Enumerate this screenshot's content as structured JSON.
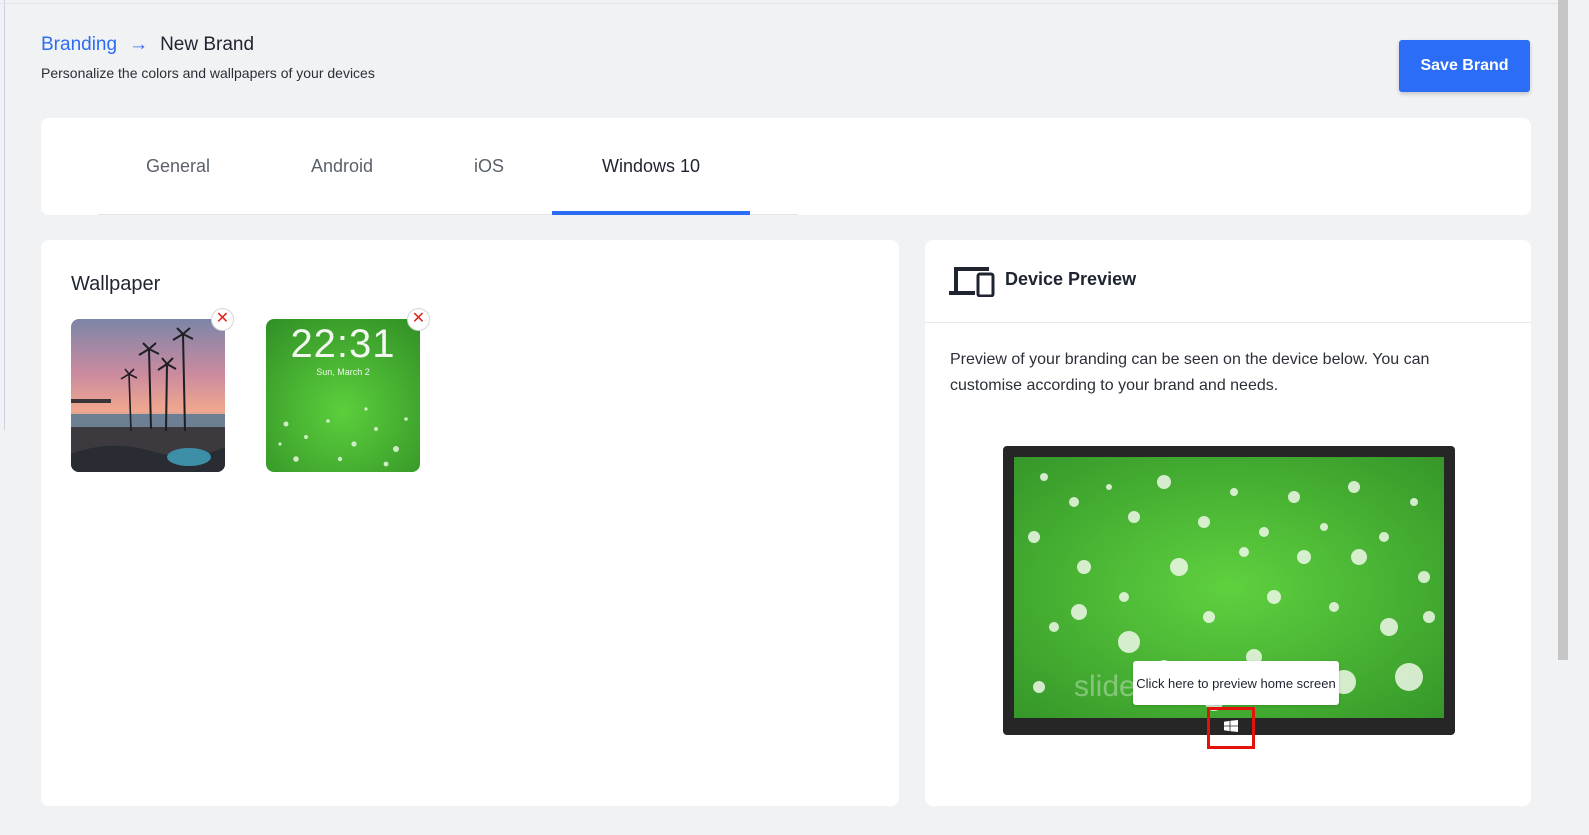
{
  "header": {
    "breadcrumb_parent": "Branding",
    "breadcrumb_arrow": "→",
    "breadcrumb_current": "New Brand",
    "subtitle": "Personalize the colors and wallpapers of your devices"
  },
  "actions": {
    "save_label": "Save Brand"
  },
  "tabs": [
    {
      "label": "General",
      "active": false
    },
    {
      "label": "Android",
      "active": false
    },
    {
      "label": "iOS",
      "active": false
    },
    {
      "label": "Windows 10",
      "active": true
    }
  ],
  "wallpaper": {
    "title": "Wallpaper",
    "remove_symbol": "✕",
    "items": [
      {
        "name": "beach-sunset"
      },
      {
        "name": "green-water-drops",
        "lock_time": "22:31",
        "lock_date": "Sun, March 2"
      }
    ]
  },
  "preview": {
    "title": "Device Preview",
    "description": "Preview of your branding can be seen on the device below. You can customise according to your brand and needs.",
    "screen_text": "slide",
    "tooltip": "Click here to preview home screen"
  },
  "colors": {
    "accent": "#2b6df6",
    "link": "#2d6cf5",
    "remove": "#e0251b",
    "highlight": "#e3120b"
  },
  "icons": {
    "arrow": "arrow-right-icon",
    "devices": "devices-icon",
    "remove": "close-icon",
    "windows": "windows-logo-icon"
  }
}
